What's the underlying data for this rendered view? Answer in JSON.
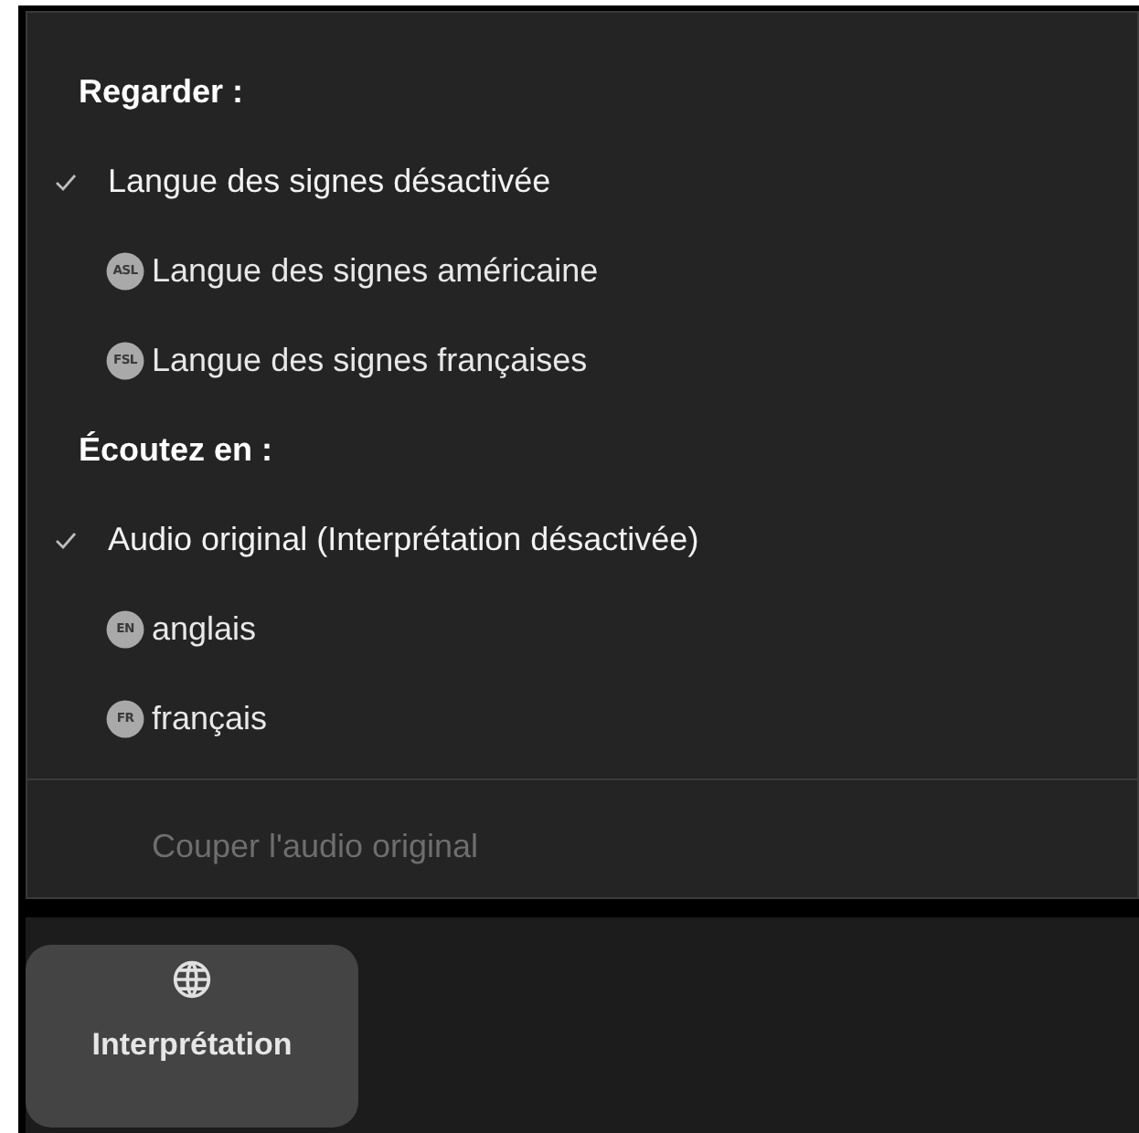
{
  "menu": {
    "sections": [
      {
        "heading": "Regarder :",
        "items": [
          {
            "label": "Langue des signes désactivée",
            "selected": true
          },
          {
            "label": "Langue des signes américaine",
            "badge": "ASL",
            "selected": false
          },
          {
            "label": "Langue des signes françaises",
            "badge": "FSL",
            "selected": false
          }
        ]
      },
      {
        "heading": "Écoutez en :",
        "items": [
          {
            "label": "Audio original (Interprétation désactivée)",
            "selected": true
          },
          {
            "label": "anglais",
            "badge": "EN",
            "selected": false
          },
          {
            "label": "français",
            "badge": "FR",
            "selected": false
          }
        ]
      }
    ],
    "footer_item": {
      "label": "Couper l'audio original",
      "disabled": true
    }
  },
  "toolbar": {
    "button": {
      "label": "Interprétation",
      "selected": true
    }
  }
}
